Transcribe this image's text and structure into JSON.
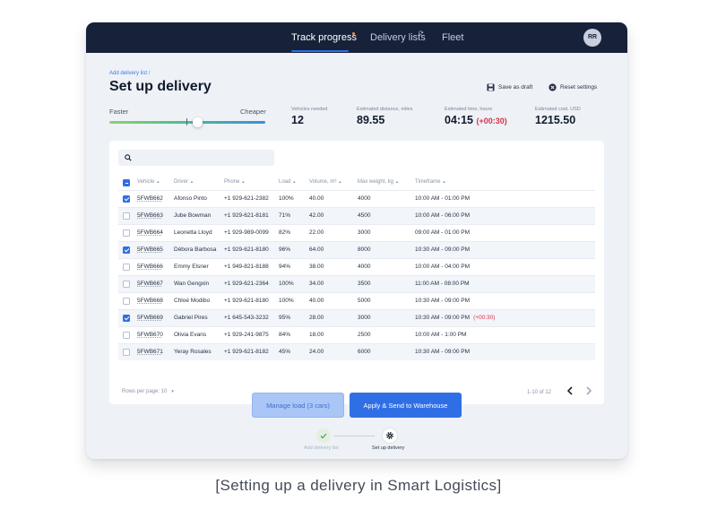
{
  "nav": {
    "tabs": [
      {
        "label": "Track progress"
      },
      {
        "label": "Delivery lists"
      },
      {
        "label": "Fleet"
      }
    ],
    "sync_glyph": "⟳",
    "avatar_initials": "RR",
    "notification_dot_color": "#ff8a3d"
  },
  "breadcrumb": {
    "link": "Add delivery list",
    "separator": "/"
  },
  "page_title": "Set up delivery",
  "actions": {
    "save_draft": "Save as draft",
    "reset": "Reset settings"
  },
  "slider": {
    "left_label": "Faster",
    "right_label": "Cheaper",
    "value": 0.57
  },
  "stats": [
    {
      "label": "Vehicles needed",
      "value": "12",
      "delta": ""
    },
    {
      "label": "Estimated distance, miles",
      "value": "89.55",
      "delta": ""
    },
    {
      "label": "Estimated time, hours",
      "value": "04:15",
      "delta": "(+00:30)"
    },
    {
      "label": "Estimated cost, USD",
      "value": "1215.50",
      "delta": ""
    }
  ],
  "search": {
    "value": "",
    "placeholder": ""
  },
  "table": {
    "sort_glyph": "▲",
    "columns": [
      {
        "label": "Vehicle"
      },
      {
        "label": "Driver"
      },
      {
        "label": "Phone"
      },
      {
        "label": "Load"
      },
      {
        "label": "Volume, m³"
      },
      {
        "label": "Max weight, kg"
      },
      {
        "label": "Timeframe"
      }
    ],
    "rows": [
      {
        "checked": true,
        "vehicle": "5FWB662",
        "driver": "Afonso Pinto",
        "phone": "+1 929-621-2382",
        "load": "100%",
        "volume": "40.00",
        "weight": "4000",
        "timeframe": "10:00 AM - 01:00 PM",
        "delta": ""
      },
      {
        "checked": false,
        "vehicle": "5FWB663",
        "driver": "Jube Bowman",
        "phone": "+1 929-621-8181",
        "load": "71%",
        "volume": "42.00",
        "weight": "4500",
        "timeframe": "10:00 AM - 06:00 PM",
        "delta": ""
      },
      {
        "checked": false,
        "vehicle": "5FWB664",
        "driver": "Leonetta Lloyd",
        "phone": "+1 929-989-0099",
        "load": "82%",
        "volume": "22.00",
        "weight": "3000",
        "timeframe": "09:00 AM - 01:00 PM",
        "delta": ""
      },
      {
        "checked": true,
        "vehicle": "5FWB665",
        "driver": "Dèbora Barbosa",
        "phone": "+1 929-621-8180",
        "load": "96%",
        "volume": "64.00",
        "weight": "8000",
        "timeframe": "10:30 AM - 09:00 PM",
        "delta": ""
      },
      {
        "checked": false,
        "vehicle": "5FWB666",
        "driver": "Emmy Elsner",
        "phone": "+1 949-821-8188",
        "load": "94%",
        "volume": "38.00",
        "weight": "4000",
        "timeframe": "10:00 AM - 04:00 PM",
        "delta": ""
      },
      {
        "checked": false,
        "vehicle": "5FWB667",
        "driver": "Wan Gengxin",
        "phone": "+1 929-621-2364",
        "load": "100%",
        "volume": "34.00",
        "weight": "3500",
        "timeframe": "11:00 AM - 08:00 PM",
        "delta": ""
      },
      {
        "checked": false,
        "vehicle": "5FWB668",
        "driver": "Chloé Modibo",
        "phone": "+1 929-621-8180",
        "load": "100%",
        "volume": "40.00",
        "weight": "5000",
        "timeframe": "10:30 AM - 09:00 PM",
        "delta": ""
      },
      {
        "checked": true,
        "vehicle": "5FWB669",
        "driver": "Gabriel Pires",
        "phone": "+1 645-543-3232",
        "load": "95%",
        "volume": "28.00",
        "weight": "3000",
        "timeframe": "10:30 AM - 09:00 PM",
        "delta": "(+00:30)"
      },
      {
        "checked": false,
        "vehicle": "5FWB670",
        "driver": "Olivia Evans",
        "phone": "+1 929-241-9875",
        "load": "84%",
        "volume": "18.00",
        "weight": "2500",
        "timeframe": "10:00 AM - 1:00 PM",
        "delta": ""
      },
      {
        "checked": false,
        "vehicle": "5FWB671",
        "driver": "Yeray Rosales",
        "phone": "+1 929-621-8182",
        "load": "45%",
        "volume": "24.00",
        "weight": "6000",
        "timeframe": "10:30 AM - 09:00 PM",
        "delta": ""
      }
    ]
  },
  "pagination": {
    "rows_per_page": "Rows per page: 10",
    "caret": "▼",
    "range": "1-10 of 12"
  },
  "buttons": {
    "manage": "Manage load (3 cars)",
    "apply": "Apply & Send to Warehouse"
  },
  "steps": [
    {
      "label": "Add delivery list",
      "icon": "check-icon",
      "state": "done"
    },
    {
      "label": "Set up delivery",
      "icon": "gear-icon",
      "state": "current"
    }
  ],
  "caption": "[Setting up a delivery in Smart Logistics]",
  "colors": {
    "nav_bg": "#17213a",
    "accent": "#2f6fe6",
    "alert": "#d8334a",
    "success": "#4caf50"
  }
}
